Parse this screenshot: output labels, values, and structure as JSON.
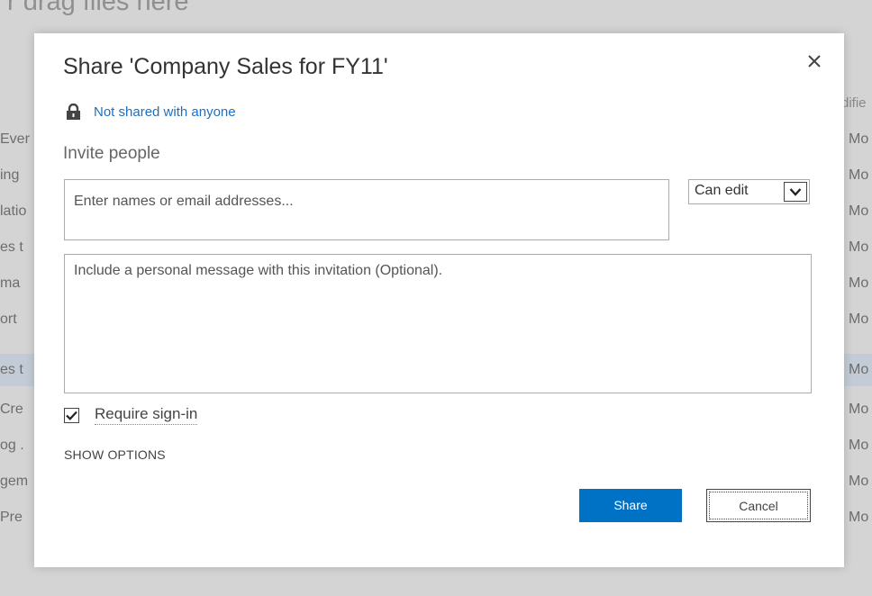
{
  "background": {
    "drag_text": "r drag files here",
    "header_right": "difie",
    "left_column": [
      "Ever",
      "ing",
      "latio",
      "es t",
      "ma",
      "ort",
      "es t",
      "Cre",
      "og .",
      "gem",
      "Pre"
    ],
    "right_column": [
      "Mo",
      "Mo",
      "Mo",
      "Mo",
      "Mo",
      "Mo",
      "Mo",
      "Mo",
      "Mo",
      "Mo",
      "Mo"
    ]
  },
  "dialog": {
    "title": "Share 'Company Sales for FY11'",
    "close_icon": "close-icon",
    "share_status": {
      "icon": "lock-icon",
      "text": "Not shared with anyone"
    },
    "invite_label": "Invite people",
    "people_input_placeholder": "Enter names or email addresses...",
    "permission": {
      "selected": "Can edit",
      "icon": "chevron-down-icon"
    },
    "message_placeholder": "Include a personal message with this invitation (Optional).",
    "require_signin": {
      "label": "Require sign-in",
      "checked": true
    },
    "show_options_label": "SHOW OPTIONS",
    "share_button": "Share",
    "cancel_button": "Cancel",
    "colors": {
      "accent": "#0072c6",
      "link": "#1f6fbf"
    }
  }
}
